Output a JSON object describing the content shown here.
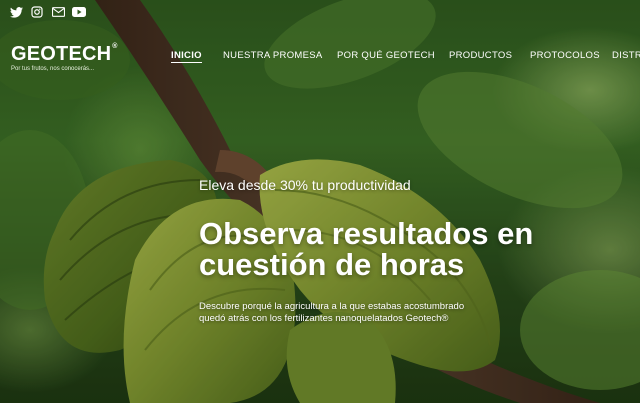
{
  "social": {
    "icons": [
      "twitter-icon",
      "instagram-icon",
      "email-icon",
      "youtube-icon"
    ]
  },
  "logo": {
    "brand": "GEOTECH",
    "registered": "®",
    "tagline": "Por tus frutos, nos conocerás..."
  },
  "nav": {
    "items": [
      {
        "label": "INICIO",
        "active": true
      },
      {
        "label": "NUESTRA PROMESA",
        "active": false
      },
      {
        "label": "POR QUÉ GEOTECH",
        "active": false
      },
      {
        "label": "PRODUCTOS",
        "active": false
      },
      {
        "label": "PROTOCOLOS",
        "active": false
      },
      {
        "label": "DISTR",
        "active": false
      }
    ]
  },
  "hero": {
    "kicker": "Eleva desde 30% tu productividad",
    "headline_line1": "Observa resultados en",
    "headline_line2": "cuestión de horas",
    "description": "Descubre porqué la agricultura a la que estabas acostumbrado quedó atrás con los fertilizantes nanoquelatados Geotech®"
  },
  "colors": {
    "text": "#ffffff",
    "foliage": "#3a6b25",
    "pod": "#8fa53a",
    "branch": "#4a3322"
  }
}
